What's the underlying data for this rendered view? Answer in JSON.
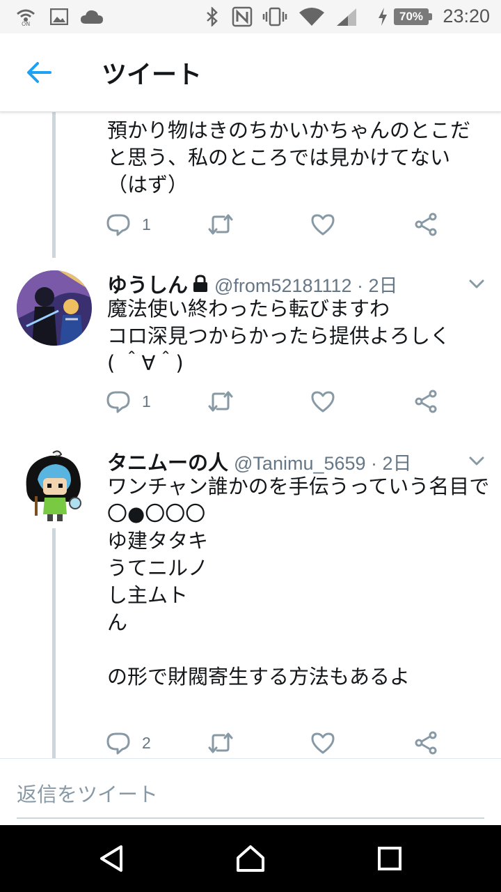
{
  "status_bar": {
    "time": "23:20",
    "battery": "70%",
    "icons": [
      "wifi-calling-icon",
      "image-icon",
      "cloud-icon",
      "bluetooth-icon",
      "nfc-icon",
      "vibrate-icon",
      "wifi-icon",
      "signal-icon",
      "charging-icon"
    ]
  },
  "header": {
    "back_icon": "arrow-left-icon",
    "title": "ツイート"
  },
  "tweets": [
    {
      "text": "預かり物はきのちかいかちゃんのとこだと思う、私のところでは見かけてない（はず）",
      "reply_count": "1"
    },
    {
      "name": "ゆうしん",
      "protected_icon": "lock-icon",
      "handle": "@from52181112 · 2日",
      "text": "魔法使い終わったら転びますわ\nコロ深見つからかったら提供よろしく\n( ＾∀＾)",
      "reply_count": "1"
    },
    {
      "name": "タニムーの人",
      "handle": "@Tanimu_5659 · 2日",
      "text": "ワンチャン誰かのを手伝うっていう名目で\n〇●〇〇〇\nゆ建タタキ\nうてニルノ\nし主ムト\nん\n\nの形で財閥寄生する方法もあるよ",
      "reply_count": "2"
    }
  ],
  "reply_bar": {
    "placeholder": "返信をツイート"
  },
  "colors": {
    "accent": "#1da1f2",
    "icon_gray": "#8899a6",
    "thread_line": "#ccd6dd"
  }
}
